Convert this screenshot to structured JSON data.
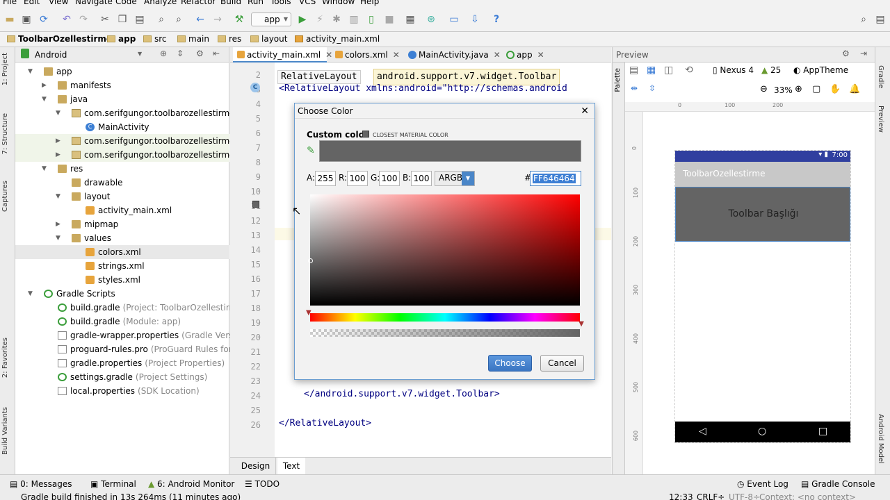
{
  "menu": [
    "File",
    "Edit",
    "View",
    "Navigate",
    "Code",
    "Analyze",
    "Refactor",
    "Build",
    "Run",
    "Tools",
    "VCS",
    "Window",
    "Help"
  ],
  "toolbar": {
    "run_config": "app"
  },
  "breadcrumb": [
    "ToolbarOzellestirme",
    "app",
    "src",
    "main",
    "res",
    "layout",
    "activity_main.xml"
  ],
  "project": {
    "view_mode": "Android",
    "tree": [
      {
        "label": "app",
        "sub": "",
        "icon": "folder",
        "indent": 0,
        "arrow": "down"
      },
      {
        "label": "manifests",
        "sub": "",
        "icon": "folder",
        "indent": 1,
        "arrow": "right"
      },
      {
        "label": "java",
        "sub": "",
        "icon": "folder",
        "indent": 1,
        "arrow": "down"
      },
      {
        "label": "com.serifgungor.toolbarozellestirme",
        "sub": "",
        "icon": "pkg",
        "indent": 2,
        "arrow": "down"
      },
      {
        "label": "MainActivity",
        "sub": "",
        "icon": "cls",
        "indent": 3,
        "arrow": ""
      },
      {
        "label": "com.serifgungor.toolbarozellestirme",
        "sub": "(andro",
        "icon": "pkg",
        "indent": 2,
        "arrow": "right"
      },
      {
        "label": "com.serifgungor.toolbarozellestirme",
        "sub": "(test)",
        "icon": "pkg",
        "indent": 2,
        "arrow": "right"
      },
      {
        "label": "res",
        "sub": "",
        "icon": "folder",
        "indent": 1,
        "arrow": "down"
      },
      {
        "label": "drawable",
        "sub": "",
        "icon": "folder",
        "indent": 2,
        "arrow": ""
      },
      {
        "label": "layout",
        "sub": "",
        "icon": "folder",
        "indent": 2,
        "arrow": "down"
      },
      {
        "label": "activity_main.xml",
        "sub": "",
        "icon": "xml",
        "indent": 3,
        "arrow": ""
      },
      {
        "label": "mipmap",
        "sub": "",
        "icon": "folder",
        "indent": 2,
        "arrow": "right"
      },
      {
        "label": "values",
        "sub": "",
        "icon": "folder",
        "indent": 2,
        "arrow": "down"
      },
      {
        "label": "colors.xml",
        "sub": "",
        "icon": "xml",
        "indent": 3,
        "arrow": ""
      },
      {
        "label": "strings.xml",
        "sub": "",
        "icon": "xml",
        "indent": 3,
        "arrow": ""
      },
      {
        "label": "styles.xml",
        "sub": "",
        "icon": "xml",
        "indent": 3,
        "arrow": ""
      },
      {
        "label": "Gradle Scripts",
        "sub": "",
        "icon": "gradle",
        "indent": 0,
        "arrow": "down"
      },
      {
        "label": "build.gradle",
        "sub": "(Project: ToolbarOzellestirme)",
        "icon": "gradle",
        "indent": 1,
        "arrow": ""
      },
      {
        "label": "build.gradle",
        "sub": "(Module: app)",
        "icon": "gradle",
        "indent": 1,
        "arrow": ""
      },
      {
        "label": "gradle-wrapper.properties",
        "sub": "(Gradle Version)",
        "icon": "file",
        "indent": 1,
        "arrow": ""
      },
      {
        "label": "proguard-rules.pro",
        "sub": "(ProGuard Rules for app)",
        "icon": "file",
        "indent": 1,
        "arrow": ""
      },
      {
        "label": "gradle.properties",
        "sub": "(Project Properties)",
        "icon": "file",
        "indent": 1,
        "arrow": ""
      },
      {
        "label": "settings.gradle",
        "sub": "(Project Settings)",
        "icon": "gradle",
        "indent": 1,
        "arrow": ""
      },
      {
        "label": "local.properties",
        "sub": "(SDK Location)",
        "icon": "file",
        "indent": 1,
        "arrow": ""
      }
    ]
  },
  "left_tool_windows": [
    "1: Project",
    "7: Structure",
    "Captures",
    "2: Favorites",
    "Build Variants"
  ],
  "right_tool_windows": [
    "Gradle",
    "Preview",
    "Android Model"
  ],
  "editor": {
    "tabs": [
      "activity_main.xml",
      "colors.xml",
      "MainActivity.java",
      "app"
    ],
    "breadcrumb": [
      "RelativeLayout",
      "android.support.v7.widget.Toolbar"
    ],
    "line_numbers": [
      "2",
      "3",
      "4",
      "5",
      "6",
      "7",
      "8",
      "9",
      "10",
      "11",
      "12",
      "13",
      "14",
      "15",
      "16",
      "17",
      "18",
      "19",
      "20",
      "21",
      "22",
      "23",
      "24",
      "25",
      "26"
    ],
    "line2": "<RelativeLayout xmlns:android=\"http://schemas.android",
    "line23": "</android.support.v7.widget.Toolbar>",
    "line25": "</RelativeLayout>",
    "bottom_tabs": [
      "Design",
      "Text"
    ]
  },
  "preview": {
    "title": "Preview",
    "device": "Nexus 4",
    "api": "25",
    "theme": "AppTheme",
    "zoom": "33%",
    "ruler_x": [
      "0",
      "100",
      "200"
    ],
    "ruler_y": [
      "0",
      "100",
      "200",
      "300",
      "400",
      "500",
      "600"
    ],
    "status_time": "7:00",
    "app_title": "ToolbarOzellestirme",
    "toolbar_text": "Toolbar Başlığı"
  },
  "dialog": {
    "title": "Choose Color",
    "custom_color_label": "Custom color",
    "closest_label": "CLOSEST MATERIAL COLOR",
    "a_label": "A:",
    "a_value": "255",
    "r_label": "R:",
    "r_value": "100",
    "g_label": "G:",
    "g_value": "100",
    "b_label": "B:",
    "b_value": "100",
    "mode": "ARGB",
    "hash": "#",
    "hex": "FF646464",
    "choose_label": "Choose",
    "cancel_label": "Cancel",
    "swatch_color": "#646464",
    "hue_color": "#ff0000"
  },
  "bottom_tools": {
    "messages": "0: Messages",
    "terminal": "Terminal",
    "monitor": "6: Android Monitor",
    "todo": "TODO",
    "event_log": "Event Log",
    "gradle_console": "Gradle Console"
  },
  "status": {
    "message": "Gradle build finished in 13s 264ms (11 minutes ago)",
    "position": "12:33",
    "line_sep": "CRLF÷",
    "encoding": "UTF-8÷",
    "context": "Context: <no context>"
  }
}
